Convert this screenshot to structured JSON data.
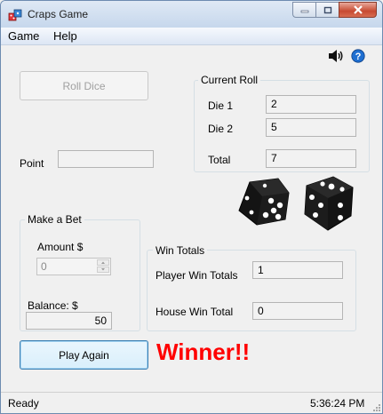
{
  "window": {
    "title": "Craps Game"
  },
  "menu": {
    "items": [
      "Game",
      "Help"
    ]
  },
  "controls": {
    "roll_dice": "Roll Dice",
    "play_again": "Play Again"
  },
  "current_roll": {
    "legend": "Current Roll",
    "die1_label": "Die 1",
    "die1_value": "2",
    "die2_label": "Die 2",
    "die2_value": "5",
    "total_label": "Total",
    "total_value": "7"
  },
  "point": {
    "label": "Point",
    "value": ""
  },
  "bet": {
    "legend": "Make a Bet",
    "amount_label": "Amount $",
    "amount_value": "0",
    "balance_label": "Balance: $",
    "balance_value": "50"
  },
  "win_totals": {
    "legend": "Win Totals",
    "player_label": "Player Win Totals",
    "player_value": "1",
    "house_label": "House Win Total",
    "house_value": "0"
  },
  "result": {
    "message": "Winner!!"
  },
  "status": {
    "left": "Ready",
    "time": "5:36:24 PM"
  },
  "dice_faces": [
    5,
    5
  ],
  "icons": [
    "app-dice-icon",
    "minimize-icon",
    "maximize-icon",
    "close-icon",
    "speaker-icon",
    "help-icon"
  ],
  "colors": {
    "winner": "#ff0000",
    "accent": "#1f6fd1"
  }
}
